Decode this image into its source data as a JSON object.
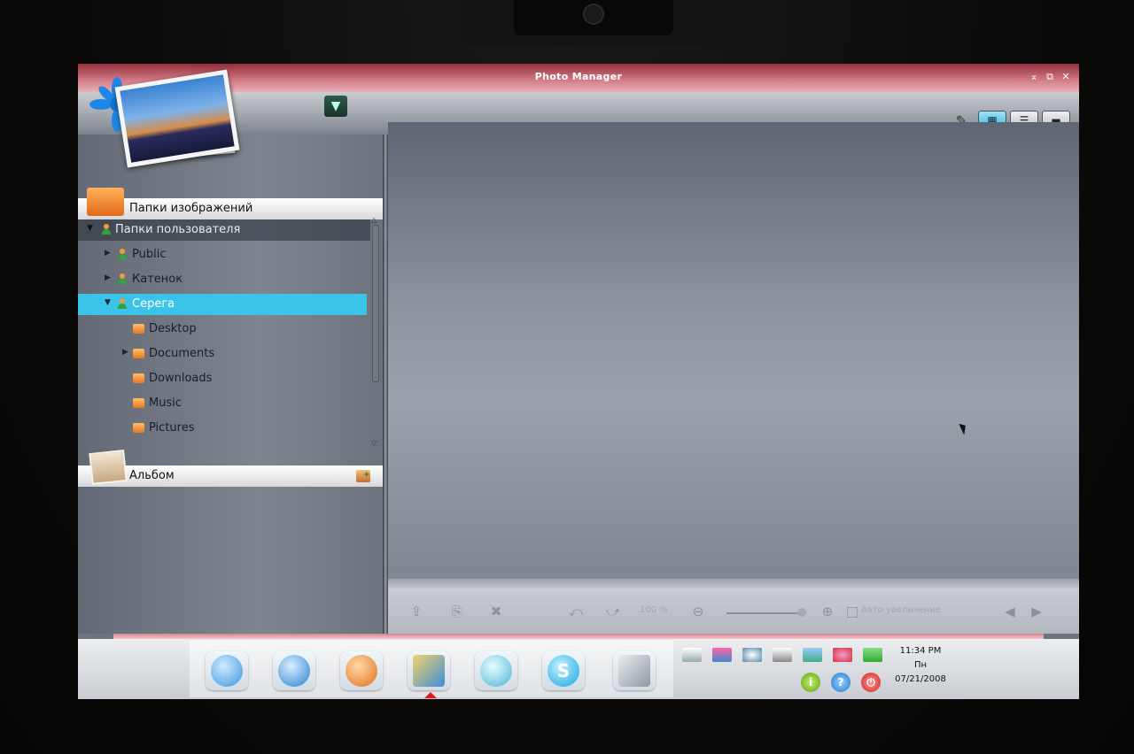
{
  "window": {
    "title": "Photo Manager",
    "controls": [
      "minimize",
      "restore",
      "close"
    ]
  },
  "toolbar": {
    "view_modes": [
      "thumbnail-view",
      "list-view",
      "preview-view"
    ],
    "active_view": "thumbnail-view"
  },
  "left_panel": {
    "folders_header": "Папки изображений",
    "tree": [
      {
        "label": "Папки пользователя",
        "icon": "user-icon",
        "expanded": true,
        "level": 0
      },
      {
        "label": "Public",
        "icon": "user-icon",
        "expanded": false,
        "level": 1
      },
      {
        "label": "Катенок",
        "icon": "user-icon",
        "expanded": false,
        "level": 1
      },
      {
        "label": "Серега",
        "icon": "user-icon",
        "expanded": true,
        "level": 1,
        "selected": true
      },
      {
        "label": "Desktop",
        "icon": "folder-icon",
        "level": 2
      },
      {
        "label": "Documents",
        "icon": "folder-icon",
        "expanded": false,
        "level": 2
      },
      {
        "label": "Downloads",
        "icon": "folder-icon",
        "level": 2
      },
      {
        "label": "Music",
        "icon": "folder-icon",
        "level": 2
      },
      {
        "label": "Pictures",
        "icon": "folder-icon",
        "level": 2
      }
    ],
    "album_header": "Альбом"
  },
  "bottom_toolbar": {
    "zoom_value": "100 %",
    "auto_zoom_label": "Авто увеличение"
  },
  "dock": {
    "apps": [
      "browser-icon",
      "messenger-icon",
      "media-icon",
      "photo-manager-icon",
      "chat-icon",
      "skype-icon",
      "settings-icon"
    ],
    "active_app": "photo-manager-icon"
  },
  "clock": {
    "time": "11:34 PM",
    "day": "Пн",
    "date": "07/21/2008"
  },
  "colors": {
    "titlebar": "#c2616e",
    "selection": "#3cc3e8",
    "accent_orange": "#e87620"
  }
}
